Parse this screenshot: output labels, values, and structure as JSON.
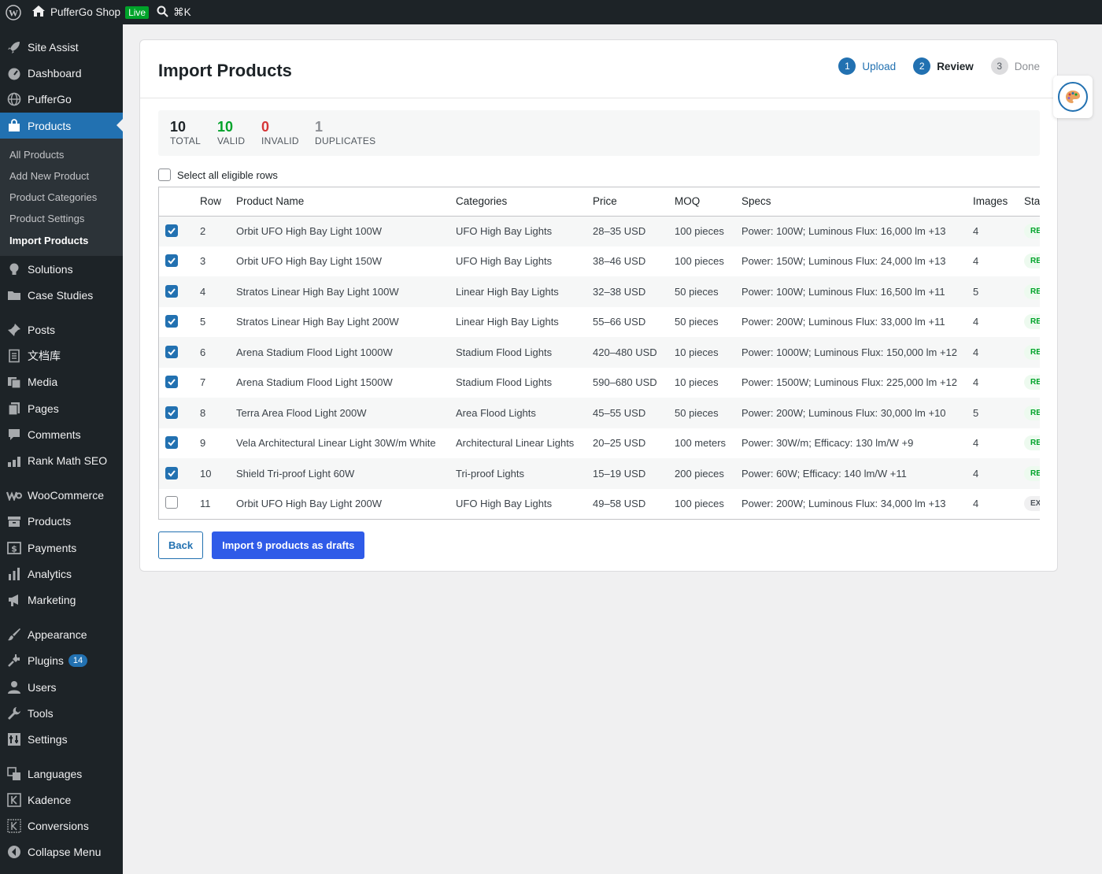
{
  "topbar": {
    "site_name": "PufferGo Shop",
    "live_badge": "Live",
    "search_shortcut": "⌘K"
  },
  "sidebar": {
    "items": [
      {
        "label": "Site Assist",
        "icon": "rocket-icon"
      },
      {
        "label": "Dashboard",
        "icon": "dashboard-icon"
      },
      {
        "label": "PufferGo",
        "icon": "globe-icon"
      },
      {
        "label": "Products",
        "icon": "bag-icon"
      },
      {
        "label": "Solutions",
        "icon": "lightbulb-icon"
      },
      {
        "label": "Case Studies",
        "icon": "folder-icon"
      },
      {
        "label": "Posts",
        "icon": "pin-icon"
      },
      {
        "label": "文档库",
        "icon": "document-icon"
      },
      {
        "label": "Media",
        "icon": "media-icon"
      },
      {
        "label": "Pages",
        "icon": "pages-icon"
      },
      {
        "label": "Comments",
        "icon": "comment-icon"
      },
      {
        "label": "Rank Math SEO",
        "icon": "chart-icon"
      },
      {
        "label": "WooCommerce",
        "icon": "woo-icon"
      },
      {
        "label": "Products",
        "icon": "archive-icon"
      },
      {
        "label": "Payments",
        "icon": "dollar-icon"
      },
      {
        "label": "Analytics",
        "icon": "bar-chart-icon"
      },
      {
        "label": "Marketing",
        "icon": "megaphone-icon"
      },
      {
        "label": "Appearance",
        "icon": "brush-icon"
      },
      {
        "label": "Plugins",
        "icon": "plug-icon",
        "badge": "14"
      },
      {
        "label": "Users",
        "icon": "user-icon"
      },
      {
        "label": "Tools",
        "icon": "wrench-icon"
      },
      {
        "label": "Settings",
        "icon": "settings-icon"
      },
      {
        "label": "Languages",
        "icon": "translate-icon"
      },
      {
        "label": "Kadence",
        "icon": "kadence-icon"
      },
      {
        "label": "Conversions",
        "icon": "conversions-icon"
      },
      {
        "label": "Collapse Menu",
        "icon": "collapse-icon"
      }
    ],
    "submenu": [
      "All Products",
      "Add New Product",
      "Product Categories",
      "Product Settings",
      "Import Products"
    ]
  },
  "page": {
    "title": "Import Products",
    "steps": [
      {
        "num": "1",
        "label": "Upload",
        "state": "done"
      },
      {
        "num": "2",
        "label": "Review",
        "state": "current"
      },
      {
        "num": "3",
        "label": "Done",
        "state": "todo"
      }
    ],
    "stats": [
      {
        "value": "10",
        "label": "TOTAL",
        "color": "#1d2327"
      },
      {
        "value": "10",
        "label": "VALID",
        "color": "#00a32a"
      },
      {
        "value": "0",
        "label": "INVALID",
        "color": "#d63638"
      },
      {
        "value": "1",
        "label": "DUPLICATES",
        "color": "#8c8f94"
      }
    ],
    "select_all_label": "Select all eligible rows",
    "columns": [
      "Row",
      "Product Name",
      "Categories",
      "Price",
      "MOQ",
      "Specs",
      "Images",
      "Sta"
    ],
    "rows": [
      {
        "checked": true,
        "row": "2",
        "name": "Orbit UFO High Bay Light 100W",
        "category": "UFO High Bay Lights",
        "price": "28–35 USD",
        "moq": "100 pieces",
        "specs": "Power: 100W; Luminous Flux: 16,000 lm +13",
        "images": "4",
        "status": "RE",
        "status_type": "ready"
      },
      {
        "checked": true,
        "row": "3",
        "name": "Orbit UFO High Bay Light 150W",
        "category": "UFO High Bay Lights",
        "price": "38–46 USD",
        "moq": "100 pieces",
        "specs": "Power: 150W; Luminous Flux: 24,000 lm +13",
        "images": "4",
        "status": "RE",
        "status_type": "ready"
      },
      {
        "checked": true,
        "row": "4",
        "name": "Stratos Linear High Bay Light 100W",
        "category": "Linear High Bay Lights",
        "price": "32–38 USD",
        "moq": "50 pieces",
        "specs": "Power: 100W; Luminous Flux: 16,500 lm +11",
        "images": "5",
        "status": "RE",
        "status_type": "ready"
      },
      {
        "checked": true,
        "row": "5",
        "name": "Stratos Linear High Bay Light 200W",
        "category": "Linear High Bay Lights",
        "price": "55–66 USD",
        "moq": "50 pieces",
        "specs": "Power: 200W; Luminous Flux: 33,000 lm +11",
        "images": "4",
        "status": "RE",
        "status_type": "ready"
      },
      {
        "checked": true,
        "row": "6",
        "name": "Arena Stadium Flood Light 1000W",
        "category": "Stadium Flood Lights",
        "price": "420–480 USD",
        "moq": "10 pieces",
        "specs": "Power: 1000W; Luminous Flux: 150,000 lm +12",
        "images": "4",
        "status": "RE",
        "status_type": "ready"
      },
      {
        "checked": true,
        "row": "7",
        "name": "Arena Stadium Flood Light 1500W",
        "category": "Stadium Flood Lights",
        "price": "590–680 USD",
        "moq": "10 pieces",
        "specs": "Power: 1500W; Luminous Flux: 225,000 lm +12",
        "images": "4",
        "status": "RE",
        "status_type": "ready"
      },
      {
        "checked": true,
        "row": "8",
        "name": "Terra Area Flood Light 200W",
        "category": "Area Flood Lights",
        "price": "45–55 USD",
        "moq": "50 pieces",
        "specs": "Power: 200W; Luminous Flux: 30,000 lm +10",
        "images": "5",
        "status": "RE",
        "status_type": "ready"
      },
      {
        "checked": true,
        "row": "9",
        "name": "Vela Architectural Linear Light 30W/m White",
        "category": "Architectural Linear Lights",
        "price": "20–25 USD",
        "moq": "100 meters",
        "specs": "Power: 30W/m; Efficacy: 130 lm/W +9",
        "images": "4",
        "status": "RE",
        "status_type": "ready"
      },
      {
        "checked": true,
        "row": "10",
        "name": "Shield Tri-proof Light 60W",
        "category": "Tri-proof Lights",
        "price": "15–19 USD",
        "moq": "200 pieces",
        "specs": "Power: 60W; Efficacy: 140 lm/W +11",
        "images": "4",
        "status": "RE",
        "status_type": "ready"
      },
      {
        "checked": false,
        "row": "11",
        "name": "Orbit UFO High Bay Light 200W",
        "category": "UFO High Bay Lights",
        "price": "49–58 USD",
        "moq": "100 pieces",
        "specs": "Power: 200W; Luminous Flux: 34,000 lm +13",
        "images": "4",
        "status": "EX",
        "status_type": "exists"
      }
    ],
    "back_label": "Back",
    "import_label": "Import 9 products as drafts"
  }
}
